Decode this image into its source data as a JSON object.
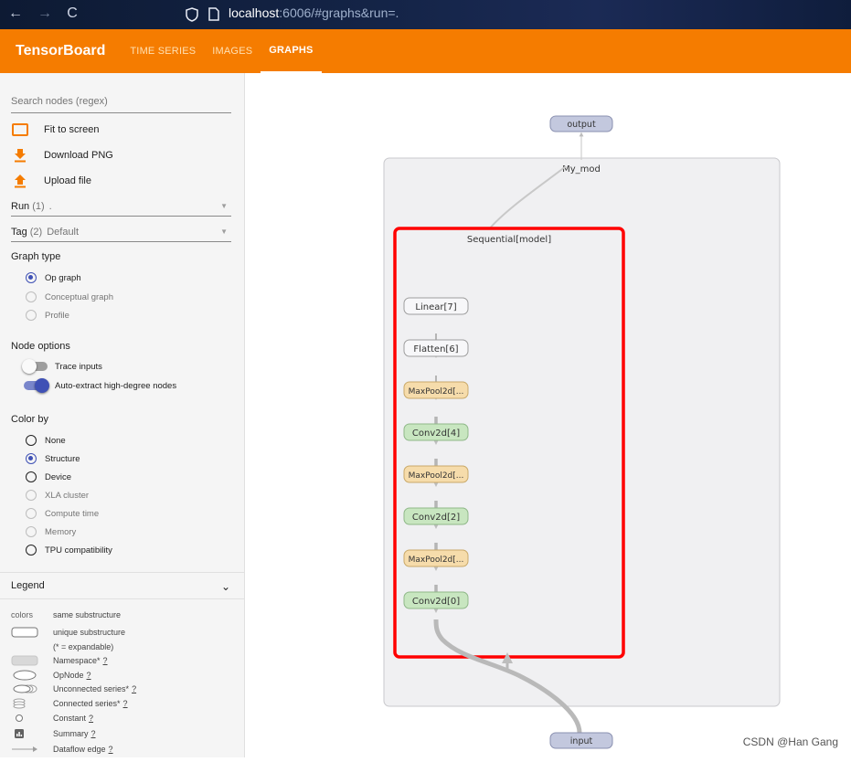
{
  "browser": {
    "back": "←",
    "forward": "→",
    "reload": "C",
    "url_host": "localhost",
    "url_rest": ":6006/#graphs&run=."
  },
  "header": {
    "brand": "TensorBoard",
    "tabs": [
      {
        "label": "TIME SERIES",
        "active": false
      },
      {
        "label": "IMAGES",
        "active": false
      },
      {
        "label": "GRAPHS",
        "active": true
      }
    ]
  },
  "sidebar": {
    "search_placeholder": "Search nodes (regex)",
    "actions": [
      "Fit to screen",
      "Download PNG",
      "Upload file"
    ],
    "run": {
      "label": "Run",
      "count": "(1)",
      "value": "."
    },
    "tag": {
      "label": "Tag",
      "count": "(2)",
      "value": "Default"
    },
    "graph_type": {
      "title": "Graph type",
      "options": [
        {
          "label": "Op graph",
          "selected": true
        },
        {
          "label": "Conceptual graph",
          "selected": false
        },
        {
          "label": "Profile",
          "selected": false
        }
      ]
    },
    "node_options": {
      "title": "Node options",
      "trace_inputs": {
        "label": "Trace inputs",
        "on": false
      },
      "auto_extract": {
        "label": "Auto-extract high-degree nodes",
        "on": true
      }
    },
    "color_by": {
      "title": "Color by",
      "options": [
        {
          "label": "None",
          "selected": false,
          "enabled": true
        },
        {
          "label": "Structure",
          "selected": true,
          "enabled": true
        },
        {
          "label": "Device",
          "selected": false,
          "enabled": true
        },
        {
          "label": "XLA cluster",
          "selected": false,
          "enabled": false
        },
        {
          "label": "Compute time",
          "selected": false,
          "enabled": false
        },
        {
          "label": "Memory",
          "selected": false,
          "enabled": false
        },
        {
          "label": "TPU compatibility",
          "selected": false,
          "enabled": true
        }
      ]
    },
    "legend": {
      "title": "Legend",
      "colors_label": "colors",
      "rows": [
        {
          "symbol": "colors",
          "text": "same substructure"
        },
        {
          "symbol": "unique",
          "text": "unique substructure"
        },
        {
          "symbol": "none",
          "text": "(* = expandable)"
        },
        {
          "symbol": "namespace",
          "text": "Namespace*",
          "help": "?"
        },
        {
          "symbol": "opnode",
          "text": "OpNode",
          "help": "?"
        },
        {
          "symbol": "unconnected",
          "text": "Unconnected series*",
          "help": "?"
        },
        {
          "symbol": "connected",
          "text": "Connected series*",
          "help": "?"
        },
        {
          "symbol": "constant",
          "text": "Constant",
          "help": "?"
        },
        {
          "symbol": "summary",
          "text": "Summary",
          "help": "?"
        },
        {
          "symbol": "dataflow",
          "text": "Dataflow edge",
          "help": "?"
        }
      ]
    }
  },
  "graph": {
    "outer_label": "My_mod",
    "inner_label": "Sequential[model]",
    "output_label": "output",
    "input_label": "input",
    "nodes": [
      {
        "label": "Linear[7]",
        "kind": "plain"
      },
      {
        "label": "Flatten[6]",
        "kind": "plain"
      },
      {
        "label": "MaxPool2d[...",
        "kind": "pool"
      },
      {
        "label": "Conv2d[4]",
        "kind": "conv"
      },
      {
        "label": "MaxPool2d[...",
        "kind": "pool"
      },
      {
        "label": "Conv2d[2]",
        "kind": "conv"
      },
      {
        "label": "MaxPool2d[...",
        "kind": "pool"
      },
      {
        "label": "Conv2d[0]",
        "kind": "conv"
      }
    ],
    "colors": {
      "conv": "#c8e6c0",
      "pool": "#f6dcab",
      "plain": "#f7f7f9",
      "io": "#c3c8de",
      "highlight": "#ff0000"
    }
  },
  "watermark": "CSDN @Han Gang"
}
